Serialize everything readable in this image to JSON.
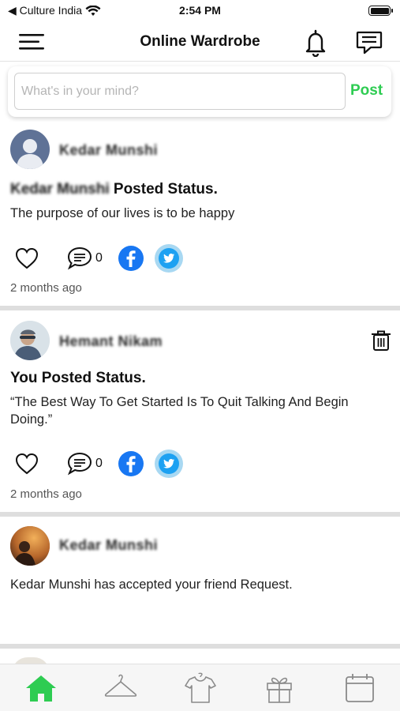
{
  "status_bar": {
    "back_label": "◀ Culture India",
    "time": "2:54 PM"
  },
  "header": {
    "title": "Online Wardrobe"
  },
  "composer": {
    "placeholder": "What's in your mind?",
    "value": "",
    "post_label": "Post"
  },
  "feed": [
    {
      "author": "Kedar Munshi",
      "title_blurred": "Kedar Munshi",
      "title_suffix": " Posted Status.",
      "body": "The purpose of our lives is to be happy",
      "comment_count": "0",
      "timestamp": "2 months ago"
    },
    {
      "author": "Hemant Nikam",
      "title": "You Posted Status.",
      "body": "“The Best Way To Get Started Is To Quit Talking And Begin Doing.”",
      "comment_count": "0",
      "timestamp": "2 months ago"
    },
    {
      "author": "Kedar Munshi",
      "body": "Kedar Munshi has accepted your friend Request."
    }
  ],
  "colors": {
    "accent": "#2ecc52",
    "facebook": "#1877f2",
    "twitter": "#1da1f2",
    "divider": "#dedede"
  },
  "bottom_nav": {
    "items": [
      "home-icon",
      "hanger-icon",
      "tshirt-icon",
      "gift-icon",
      "calendar-icon"
    ],
    "active": "home-icon"
  }
}
